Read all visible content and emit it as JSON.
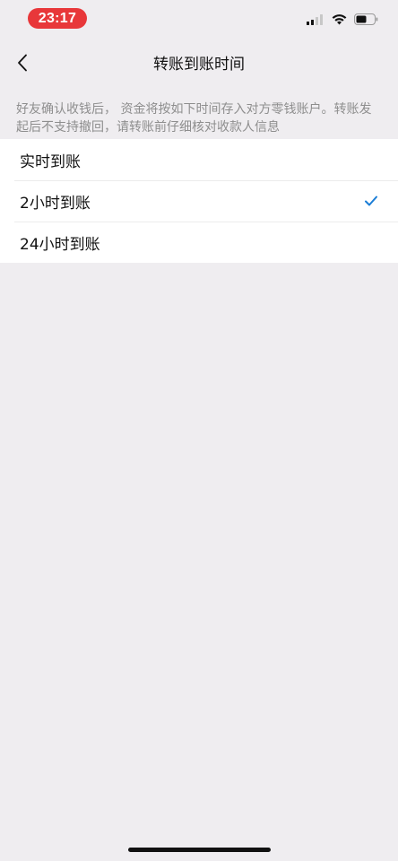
{
  "status_bar": {
    "time": "23:17",
    "icons": [
      "cellular-signal-icon",
      "wifi-icon",
      "battery-icon"
    ],
    "time_pill_color": "#E8373A"
  },
  "nav": {
    "back_icon": "chevron-left-icon",
    "title": "转账到账时间"
  },
  "description": "好友确认收钱后， 资金将按如下时间存入对方零钱账户。转账发起后不支持撤回，请转账前仔细核对收款人信息",
  "options": [
    {
      "label": "实时到账",
      "selected": false
    },
    {
      "label": "2小时到账",
      "selected": true
    },
    {
      "label": "24小时到账",
      "selected": false
    }
  ],
  "colors": {
    "background": "#EFEDF0",
    "check": "#1A7DD6",
    "secondary_text": "#8E8E8E"
  }
}
